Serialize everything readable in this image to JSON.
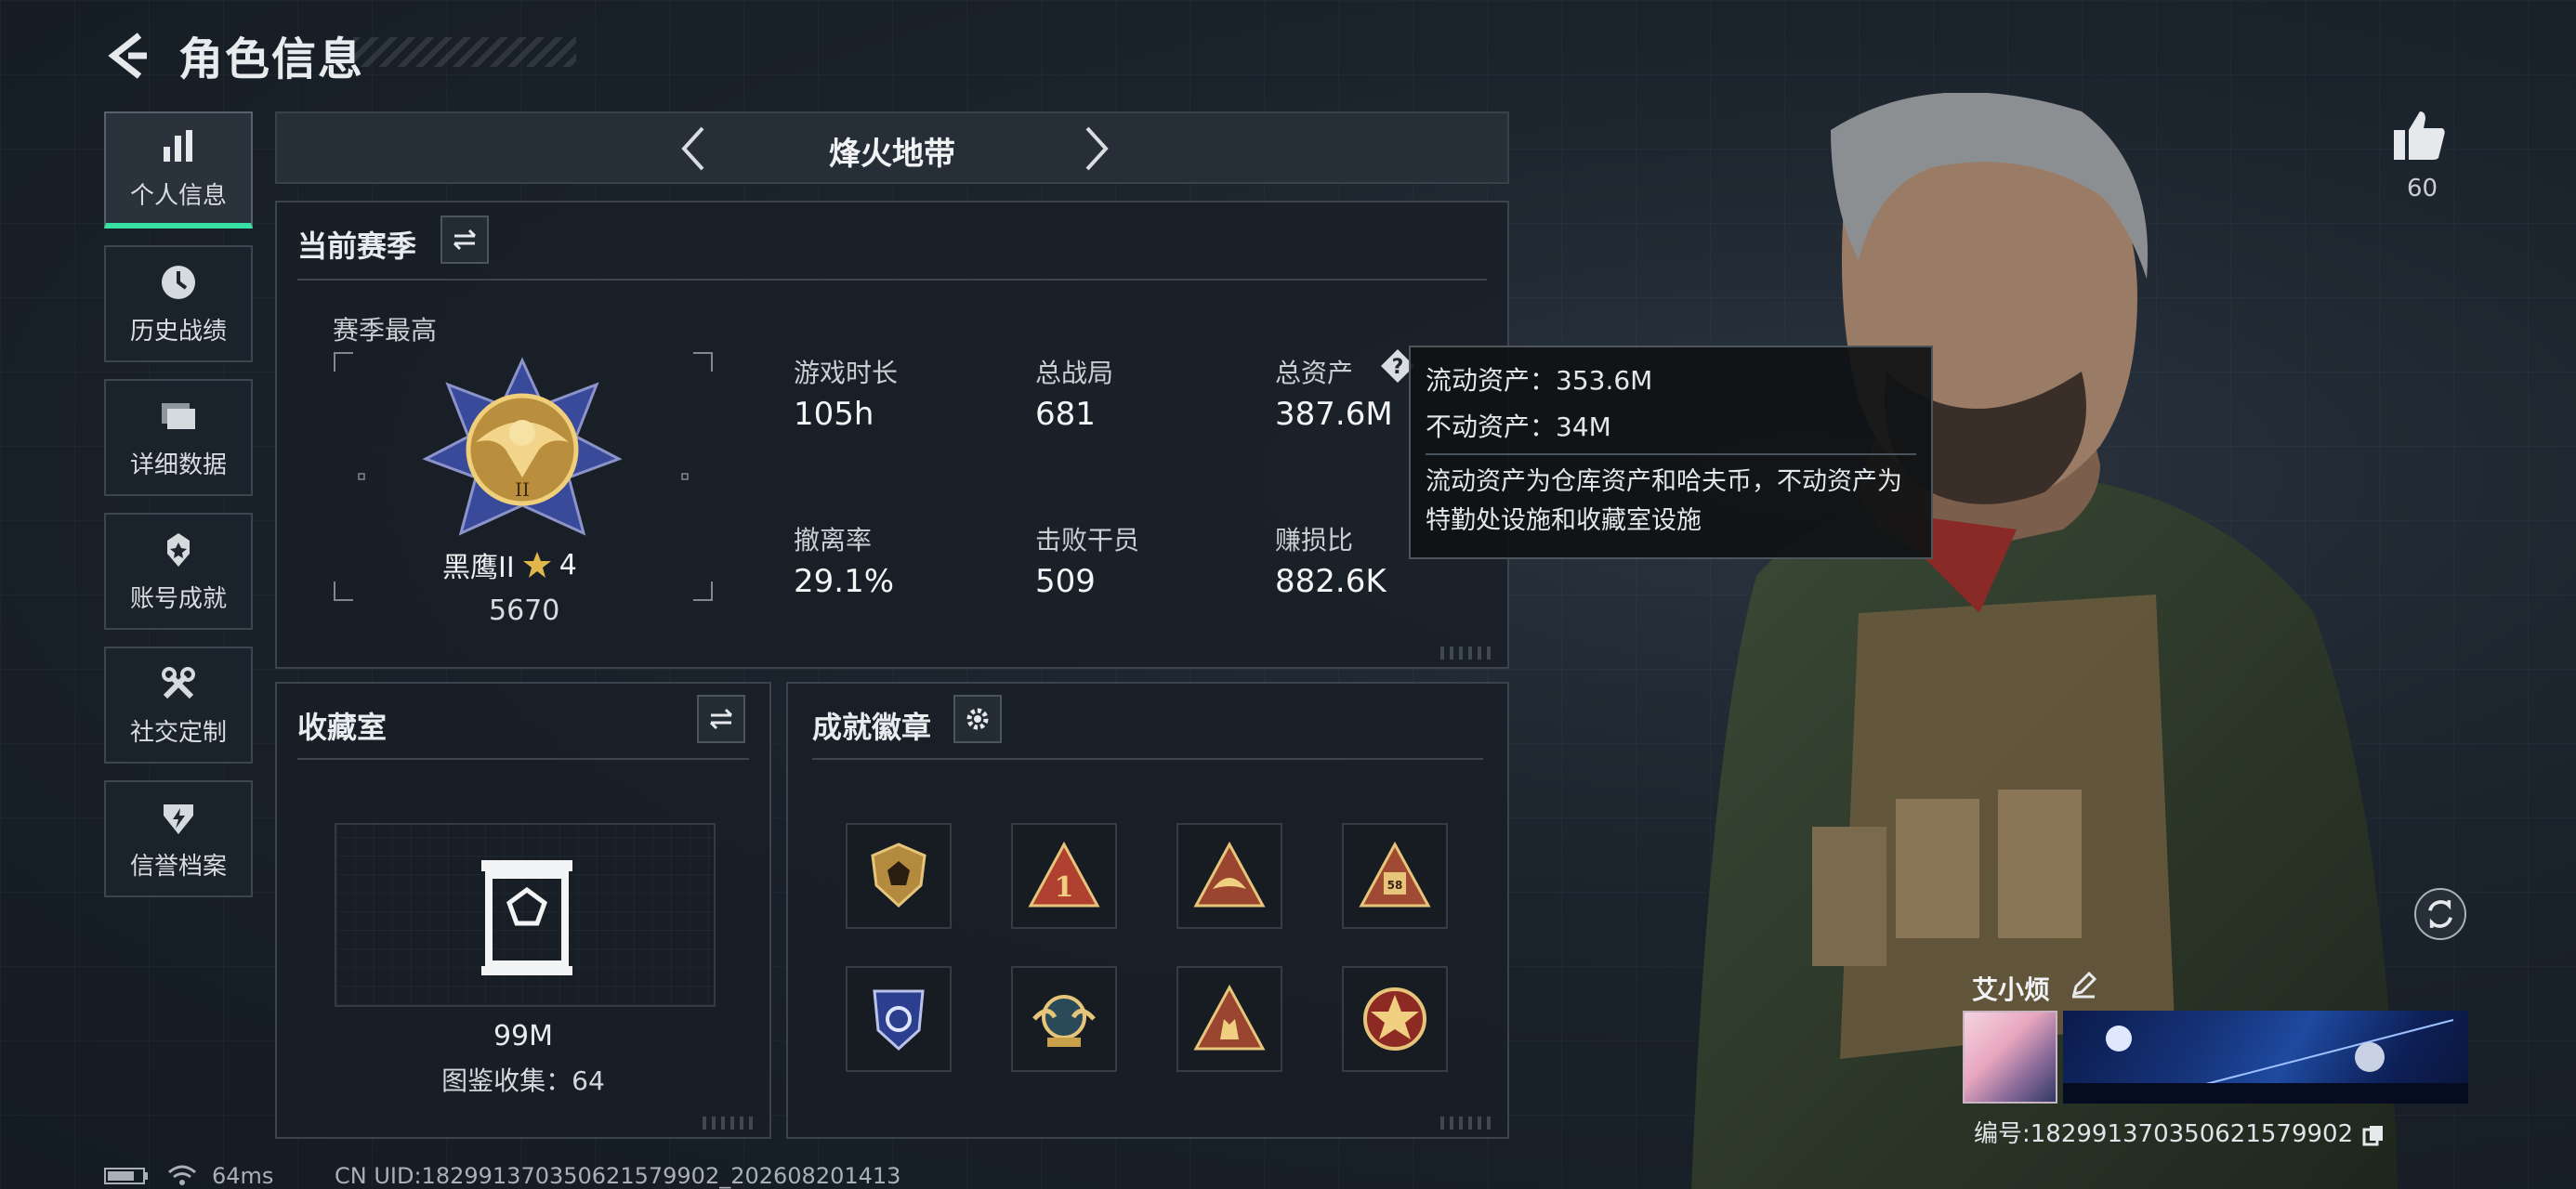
{
  "header": {
    "title": "角色信息"
  },
  "sidebar": {
    "items": [
      {
        "label": "个人信息",
        "icon": "bar-chart-icon",
        "active": true
      },
      {
        "label": "历史战绩",
        "icon": "clock-icon"
      },
      {
        "label": "详细数据",
        "icon": "folder-icon"
      },
      {
        "label": "账号成就",
        "icon": "medal-icon"
      },
      {
        "label": "社交定制",
        "icon": "tools-icon"
      },
      {
        "label": "信誉档案",
        "icon": "shield-bolt-icon"
      }
    ]
  },
  "mode": {
    "name": "烽火地带"
  },
  "season": {
    "title": "当前赛季",
    "best_label": "赛季最高",
    "rank_name": "黑鹰II",
    "rank_stars": "4",
    "rank_score": "5670",
    "stats": [
      {
        "label": "游戏时长",
        "value": "105h"
      },
      {
        "label": "总战局",
        "value": "681"
      },
      {
        "label": "总资产",
        "value": "387.6M"
      },
      {
        "label": "撤离率",
        "value": "29.1%"
      },
      {
        "label": "击败干员",
        "value": "509"
      },
      {
        "label": "赚损比",
        "value": "882.6K"
      }
    ]
  },
  "tooltip": {
    "liquid": "流动资产：353.6M",
    "fixed": "不动资产：34M",
    "desc": "流动资产为仓库资产和哈夫币，不动资产为特勤处设施和收藏室设施"
  },
  "collection": {
    "title": "收藏室",
    "value": "99M",
    "catalog": "图鉴收集：64"
  },
  "achievements": {
    "title": "成就徽章",
    "badges": [
      "badge-shield",
      "badge-first",
      "badge-triangle-gold",
      "badge-58",
      "badge-blue-shield",
      "badge-wings",
      "badge-triangle-hand",
      "badge-star-red"
    ]
  },
  "profile": {
    "likes": "60",
    "nickname": "艾小烦",
    "uid": "编号:18299137035062157990​2"
  },
  "status": {
    "ping": "64ms",
    "cn_uid": "CN UID:18299137035062157990​2_202608201413"
  },
  "colors": {
    "accent": "#37e0a4",
    "gold": "#c9a04a",
    "panel_border": "#3b444e"
  }
}
